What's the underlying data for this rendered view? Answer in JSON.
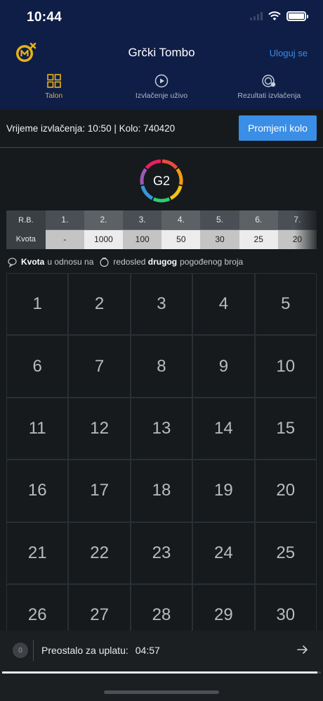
{
  "status": {
    "time": "10:44"
  },
  "header": {
    "title": "Grčki Tombo",
    "login_label": "Uloguj se"
  },
  "tabs": [
    {
      "label": "Talon",
      "icon": "grid-icon",
      "active": true
    },
    {
      "label": "Izvlačenje uživo",
      "icon": "play-icon",
      "active": false
    },
    {
      "label": "Rezultati izvlačenja",
      "icon": "results-icon",
      "active": false
    }
  ],
  "draw": {
    "info": "Vrijeme izvlačenja: 10:50 | Kolo: 740420",
    "change_button": "Promjeni kolo"
  },
  "game": {
    "badge": "G2",
    "ring_colors": [
      "#e74c3c",
      "#f39c12",
      "#f1c40f",
      "#2ecc71",
      "#3498db",
      "#9b59b6",
      "#e91e63"
    ]
  },
  "odds": {
    "row_label": "R.B.",
    "kvota_label": "Kvota",
    "columns": [
      {
        "rb": "1.",
        "kvota": "-"
      },
      {
        "rb": "2.",
        "kvota": "1000"
      },
      {
        "rb": "3.",
        "kvota": "100"
      },
      {
        "rb": "4.",
        "kvota": "50"
      },
      {
        "rb": "5.",
        "kvota": "30"
      },
      {
        "rb": "6.",
        "kvota": "25"
      },
      {
        "rb": "7.",
        "kvota": "20"
      }
    ]
  },
  "legend": {
    "kvota": "Kvota",
    "in_relation": "u odnosu na",
    "order_pre": "redosled",
    "second": "drugog",
    "order_post": "pogođenog broja"
  },
  "numbers": [
    "1",
    "2",
    "3",
    "4",
    "5",
    "6",
    "7",
    "8",
    "9",
    "10",
    "11",
    "12",
    "13",
    "14",
    "15",
    "16",
    "17",
    "18",
    "19",
    "20",
    "21",
    "22",
    "23",
    "24",
    "25",
    "26",
    "27",
    "28",
    "29",
    "30"
  ],
  "bottom": {
    "selected_count": "0",
    "remaining_label": "Preostalo za uplatu:",
    "remaining_time": "04:57",
    "progress": 0.99
  },
  "colors": {
    "accent": "#3a8ee6",
    "active_tab": "#e7b218",
    "header_bg": "#0f1e47"
  }
}
